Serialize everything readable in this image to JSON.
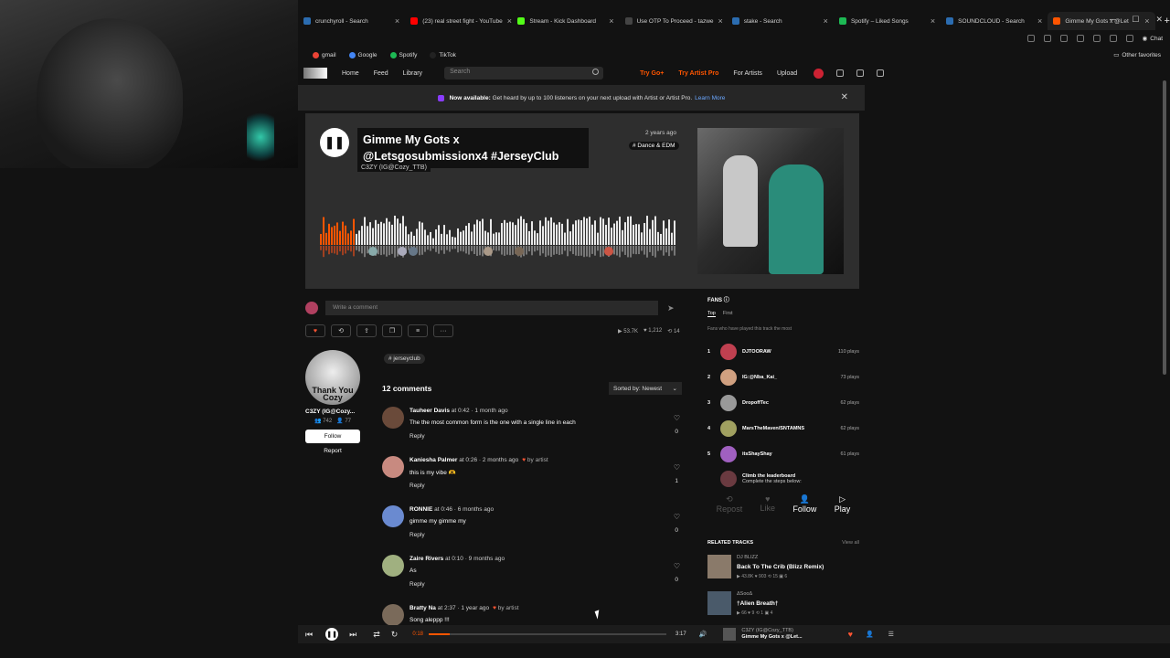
{
  "browser": {
    "tabs": [
      {
        "label": "crunchyroll - Search",
        "color": "#2b6cb0"
      },
      {
        "label": "(23) real street fight - YouTube",
        "color": "#ff0000"
      },
      {
        "label": "Stream - Kick Dashboard",
        "color": "#53fc18"
      },
      {
        "label": "Use OTP To Proceed - tazwe",
        "color": "#444444"
      },
      {
        "label": "stake - Search",
        "color": "#2b6cb0"
      },
      {
        "label": "Spotify – Liked Songs",
        "color": "#1db954"
      },
      {
        "label": "SOUNDCLOUD - Search",
        "color": "#2b6cb0"
      },
      {
        "label": "Gimme My Gots x @Let",
        "color": "#ff5500"
      }
    ],
    "chat_label": "Chat",
    "favorites": [
      {
        "label": "gmail",
        "color": "#ea4335"
      },
      {
        "label": "Google",
        "color": "#4285f4"
      },
      {
        "label": "Spotify",
        "color": "#1db954"
      },
      {
        "label": "TikTok",
        "color": "#222222"
      }
    ],
    "other_favorites": "Other favorites"
  },
  "nav": {
    "home": "Home",
    "feed": "Feed",
    "library": "Library",
    "search_placeholder": "Search",
    "try_go": "Try Go+",
    "try_artist_pro": "Try Artist Pro",
    "for_artists": "For Artists",
    "upload": "Upload"
  },
  "banner": {
    "bold": "Now available:",
    "text": "Get heard by up to 100 listeners on your next upload with Artist or Artist Pro.",
    "link": "Learn More"
  },
  "track": {
    "title": "Gimme My Gots x @Letsgosubmissionx4 #JerseyClub",
    "artist": "C3ZY (IG@Cozy_TTB)",
    "posted": "2 years ago",
    "genre": "# Dance & EDM",
    "played_fraction": 0.1
  },
  "comment_box": {
    "placeholder": "Write a comment"
  },
  "stats": {
    "plays": "53.7K",
    "likes": "1,212",
    "reposts": "14"
  },
  "uploader": {
    "pic_text": "Thank You Cozy",
    "name": "C3ZY (IG@Cozy...",
    "followers": "742",
    "following": "77",
    "follow": "Follow",
    "report": "Report"
  },
  "tag": "# jerseyclub",
  "comments_header": {
    "count": "12 comments",
    "sort": "Sorted by: Newest"
  },
  "comments": [
    {
      "user": "Tauheer Davis",
      "at": "at 0:42 · 1 month ago",
      "by_artist": "",
      "text": "The the most common form is the one with a single line in each",
      "reply": "Reply",
      "likes": "0",
      "avatar_color": "#6a4a3a"
    },
    {
      "user": "Kaniesha Palmer",
      "at": "at 0:26 · 2 months ago",
      "by_artist": "by artist",
      "text": "this is my vibe 🫶",
      "reply": "Reply",
      "likes": "1",
      "avatar_color": "#c88a80"
    },
    {
      "user": "RONNIE",
      "at": "at 0:46 · 6 months ago",
      "by_artist": "",
      "text": "gimme my gimme my",
      "reply": "Reply",
      "likes": "0",
      "avatar_color": "#6a8ad0"
    },
    {
      "user": "Zaire Rivers",
      "at": "at 0:10 · 9 months ago",
      "by_artist": "",
      "text": "As",
      "reply": "Reply",
      "likes": "0",
      "avatar_color": "#a0b080"
    },
    {
      "user": "Bratty Na",
      "at": "at 2:37 · 1 year ago",
      "by_artist": "by artist",
      "text": "Song aleppp !!!",
      "reply": "",
      "likes": "",
      "avatar_color": "#7a6a5a"
    }
  ],
  "fans": {
    "header": "FANS",
    "tab_top": "Top",
    "tab_first": "First",
    "subtitle": "Fans who have played this track the most",
    "list": [
      {
        "rank": "1",
        "name": "DJTOORAW",
        "plays": "110 plays",
        "color": "#c04050"
      },
      {
        "rank": "2",
        "name": "IG:@Nba_Kai_",
        "plays": "73 plays",
        "color": "#d0a080"
      },
      {
        "rank": "3",
        "name": "DropoffTec",
        "plays": "62 plays",
        "color": "#999999"
      },
      {
        "rank": "4",
        "name": "MarsTheMaven/SNTAMNS",
        "plays": "62 plays",
        "color": "#a0a060"
      },
      {
        "rank": "5",
        "name": "itsShayShay",
        "plays": "61 plays",
        "color": "#a060c0"
      }
    ],
    "climb_title": "Climb the leaderboard",
    "climb_sub": "Complete the steps below:",
    "steps": [
      {
        "label": "Repost",
        "icon": "⟲"
      },
      {
        "label": "Like",
        "icon": "♥"
      },
      {
        "label": "Follow",
        "icon": "👤"
      },
      {
        "label": "Play",
        "icon": "▷"
      }
    ]
  },
  "related": {
    "header": "RELATED TRACKS",
    "view_all": "View all",
    "tracks": [
      {
        "artist": "DJ BLIZZ",
        "title": "Back To The Crib (Blizz Remix)",
        "stats": "▶ 43.8K ♥ 903 ⟲ 15 ▣ 6",
        "color": "#8a7a6a"
      },
      {
        "artist": "ΔSooΔ",
        "title": "†Alien Breath†",
        "stats": "▶ 66 ♥ 9 ⟲ 1 ▣ 4",
        "color": "#4a5a6a"
      }
    ]
  },
  "player": {
    "elapsed": "0:18",
    "total": "3:17",
    "progress_fraction": 0.09,
    "artist": "C3ZY (IG@Cozy_TTB)",
    "title": "Gimme My Gots x @Let..."
  }
}
